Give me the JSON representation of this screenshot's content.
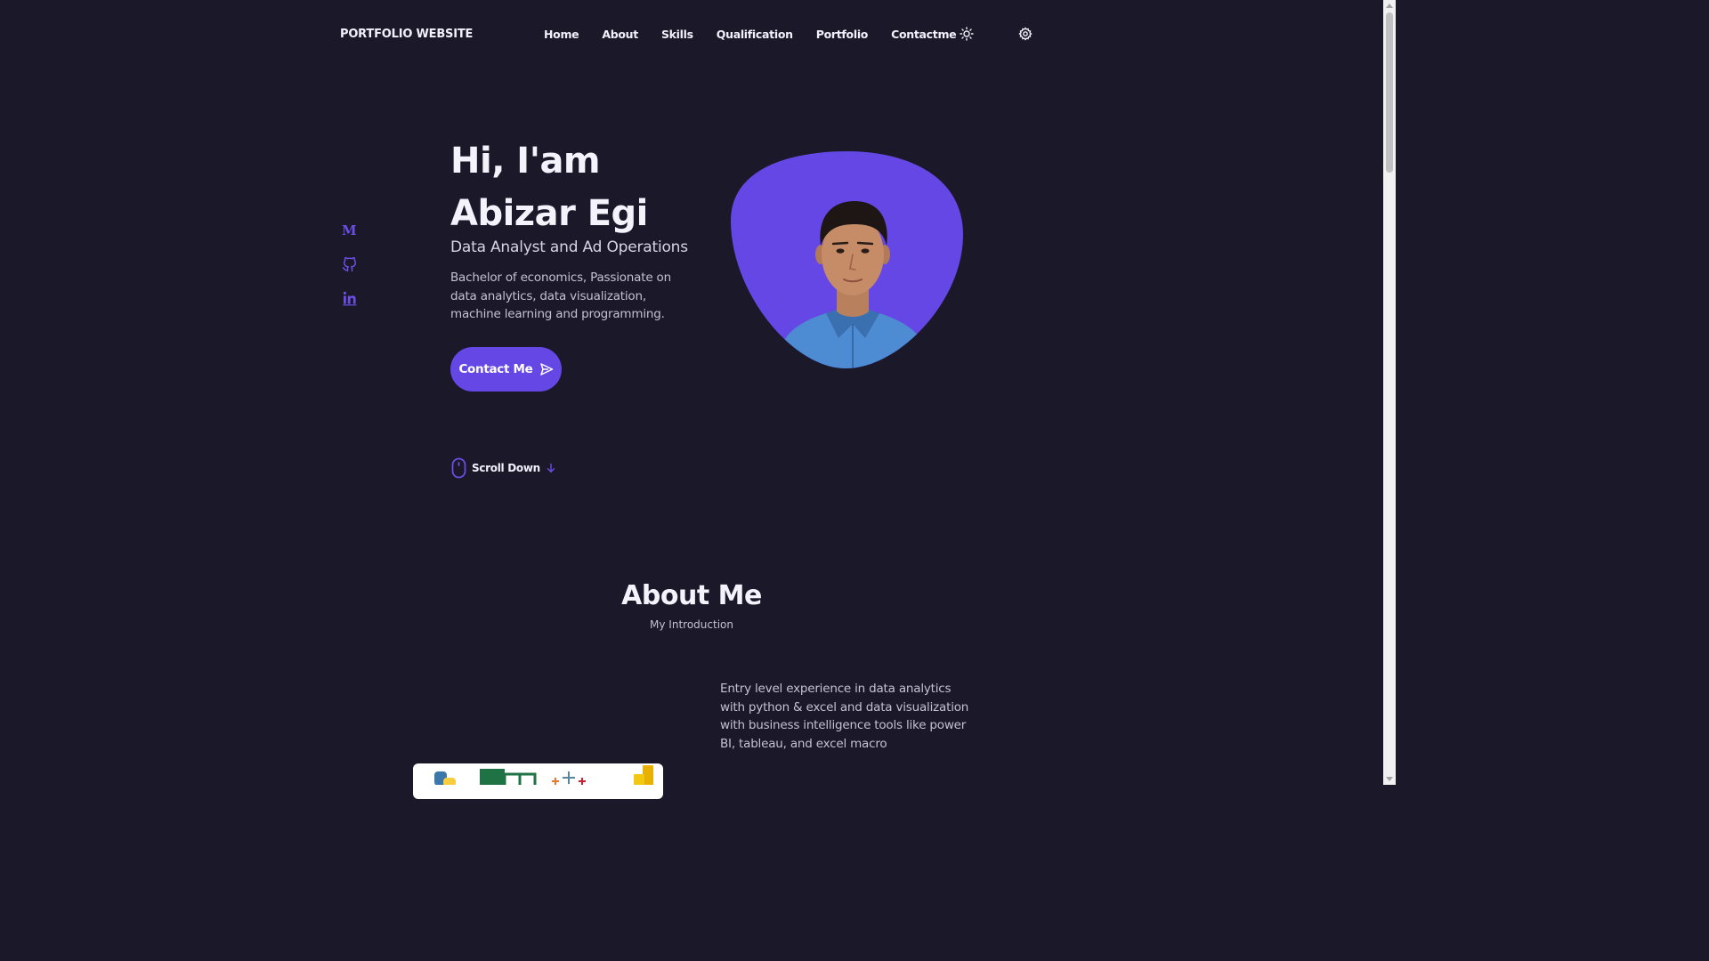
{
  "header": {
    "logo": "PORTFOLIO WEBSITE",
    "nav": [
      "Home",
      "About",
      "Skills",
      "Qualification",
      "Portfolio",
      "Contactme"
    ],
    "theme_icon": "sun-icon",
    "settings_icon": "gear-icon"
  },
  "social": [
    {
      "name": "medium-icon",
      "glyph": "M"
    },
    {
      "name": "github-icon"
    },
    {
      "name": "linkedin-icon"
    }
  ],
  "hero": {
    "title_line1": "Hi, I'am",
    "title_line2": "Abizar Egi",
    "subtitle": "Data Analyst and Ad Operations",
    "description": "Bachelor of economics, Passionate on data analytics, data visualization, machine learning and programming.",
    "contact_button": "Contact Me",
    "scroll_down": "Scroll Down"
  },
  "about": {
    "title": "About Me",
    "subtitle": "My Introduction",
    "description": "Entry level experience in data analytics with python & excel and data visualization with business intelligence tools like power BI, tableau, and excel macro"
  },
  "colors": {
    "background": "#1b1829",
    "accent": "#6547e6"
  }
}
